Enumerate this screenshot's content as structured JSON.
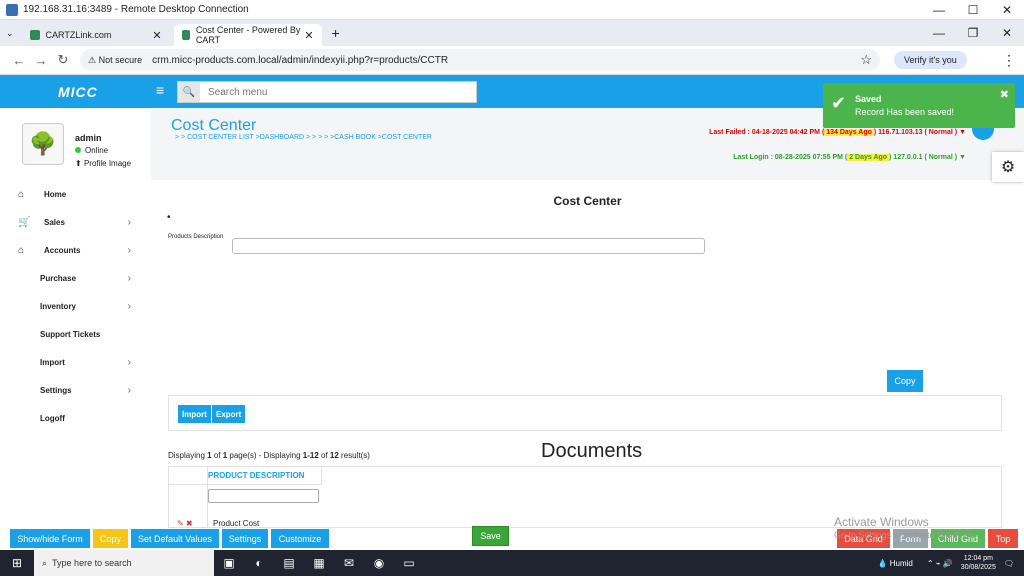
{
  "window": {
    "title": "192.168.31.16:3489 - Remote Desktop Connection"
  },
  "browser": {
    "tabs": [
      {
        "label": "CARTZLink.com"
      },
      {
        "label": "Cost Center - Powered By CART"
      }
    ],
    "security": "Not secure",
    "url": "crm.micc-products.com.local/admin/indexyii.php?r=products/CCTR",
    "verify": "Verify it's you"
  },
  "app": {
    "logo": "MICC",
    "search_placeholder": "Search menu",
    "profile": {
      "name": "admin",
      "status": "Online",
      "image_label": "Profile Image"
    },
    "menu": [
      {
        "label": "Home",
        "icon": "home-icon",
        "glyph": "⌂",
        "sub": false,
        "chev": false
      },
      {
        "label": "Sales",
        "icon": "cart-icon",
        "glyph": "🛒",
        "sub": false,
        "chev": true
      },
      {
        "label": "Accounts",
        "icon": "bank-icon",
        "glyph": "⌂",
        "sub": false,
        "chev": true
      },
      {
        "label": "Purchase",
        "sub": true,
        "chev": true
      },
      {
        "label": "Inventory",
        "sub": true,
        "chev": true
      },
      {
        "label": "Support Tickets",
        "sub": true,
        "chev": false
      },
      {
        "label": "Import",
        "sub": true,
        "chev": true
      },
      {
        "label": "Settings",
        "sub": true,
        "chev": true
      },
      {
        "label": "Logoff",
        "sub": true,
        "chev": false
      }
    ]
  },
  "page": {
    "title": "Cost Center",
    "breadcrumb": "> > COST CENTER LIST  >DASHBOARD  > > > > >CASH BOOK  >COST CENTER",
    "last_failed": {
      "prefix": "Last Failed : 04-18-2025 04:42 PM (",
      "ago": " 134 Days Ago ",
      "suffix": ") 116.71.103.13 ( Normal ) ▼"
    },
    "last_login": {
      "prefix": "Last Login : 08-28-2025 07:55 PM (",
      "ago": " 2 Days Ago ",
      "suffix": ") 127.0.0.1 ( Normal ) ▼"
    },
    "form_title": "Cost Center",
    "field_label": "Products Description",
    "copy": "Copy",
    "import": "Import",
    "export": "Export",
    "display": {
      "a": "Displaying ",
      "p1": "1",
      "b": " of ",
      "p2": "1",
      "c": " page(s)  -  Displaying ",
      "r1": "1-12",
      "d": " of ",
      "r2": "12",
      "e": " result(s)"
    },
    "documents": "Documents",
    "grid": {
      "header": "PRODUCT DESCRIPTION",
      "row": "Product Cost"
    }
  },
  "toast": {
    "title": "Saved",
    "message": "Record Has been saved!"
  },
  "bottom": {
    "show_hide": "Show/hide Form",
    "copy": "Copy",
    "set_default": "Set Default Values",
    "settings": "Settings",
    "customize": "Customize",
    "save": "Save",
    "data_grid": "Data Grid",
    "form": "Form",
    "child_grid": "Child Grid",
    "top": "Top"
  },
  "watermark": {
    "line1": "Activate Windows",
    "line2": "Go to Settings to activate Windows."
  },
  "taskbar": {
    "search": "Type here to search",
    "weather": "Humid",
    "time": "12:04 pm",
    "date": "30/08/2025"
  },
  "colors": {
    "accent": "#1aa0e6",
    "success": "#4bb44b",
    "danger": "#e74c3c",
    "warning": "#f5c518"
  }
}
